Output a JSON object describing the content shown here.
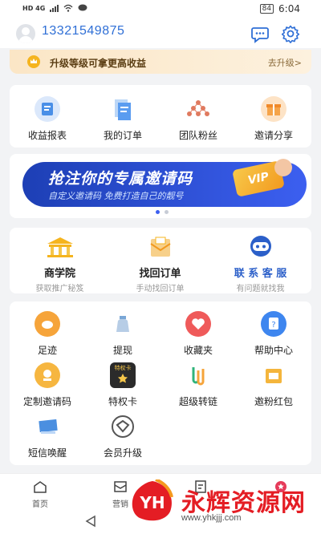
{
  "status_bar": {
    "left": "HD 4G",
    "battery": "84",
    "time": "6:04"
  },
  "header": {
    "phone": "13321549875"
  },
  "upgrade_banner": {
    "text": "升级等级可拿更高收益",
    "action": "去升级>"
  },
  "top_menu": [
    {
      "label": "收益报表",
      "icon": "revenue-report-icon",
      "color": "#4a8fe7"
    },
    {
      "label": "我的订单",
      "icon": "my-orders-icon",
      "color": "#5a9cf0"
    },
    {
      "label": "团队粉丝",
      "icon": "team-fans-icon",
      "color": "#e07a5f"
    },
    {
      "label": "邀请分享",
      "icon": "invite-share-icon",
      "color": "#f5a44a"
    }
  ],
  "promo_banner": {
    "title": "抢注你的专属邀请码",
    "subtitle": "自定义邀请码 免费打造自己的靓号",
    "badge": "VIP"
  },
  "services": [
    {
      "title": "商学院",
      "subtitle": "获取推广秘笈",
      "icon": "business-school-icon"
    },
    {
      "title": "找回订单",
      "subtitle": "手动找回订单",
      "icon": "retrieve-order-icon"
    },
    {
      "title": "联 系 客 服",
      "subtitle": "有问题就找我",
      "icon": "customer-service-icon"
    }
  ],
  "tools": [
    {
      "label": "足迹",
      "icon": "footprint-icon",
      "color": "#f6a43a"
    },
    {
      "label": "提现",
      "icon": "withdraw-icon",
      "color": "#7aa7d6"
    },
    {
      "label": "收藏夹",
      "icon": "favorites-icon",
      "color": "#ef5a5a"
    },
    {
      "label": "帮助中心",
      "icon": "help-center-icon",
      "color": "#3e86ef"
    },
    {
      "label": "定制邀请码",
      "icon": "custom-invite-code-icon",
      "color": "#f6b640"
    },
    {
      "label": "特权卡",
      "icon": "privilege-card-icon",
      "color": "#2b2b2b",
      "badge": "特权卡"
    },
    {
      "label": "超级转链",
      "icon": "super-link-icon",
      "color": "#2fb37a"
    },
    {
      "label": "邀粉红包",
      "icon": "red-packet-icon",
      "color": "#f4b53c"
    },
    {
      "label": "短信唤醒",
      "icon": "sms-wake-icon",
      "color": "#4b8fe0"
    },
    {
      "label": "会员升级",
      "icon": "member-upgrade-icon",
      "color": "#555555"
    }
  ],
  "bottom_nav": [
    {
      "label": "首页",
      "icon": "home-icon"
    },
    {
      "label": "营销",
      "icon": "marketing-icon"
    },
    {
      "label": "",
      "icon": "list-icon"
    },
    {
      "label": "",
      "icon": "profile-icon"
    }
  ],
  "watermark": {
    "brand": "永辉资源网",
    "logo_text": "YH",
    "url": "www.yhkjjj.com"
  }
}
